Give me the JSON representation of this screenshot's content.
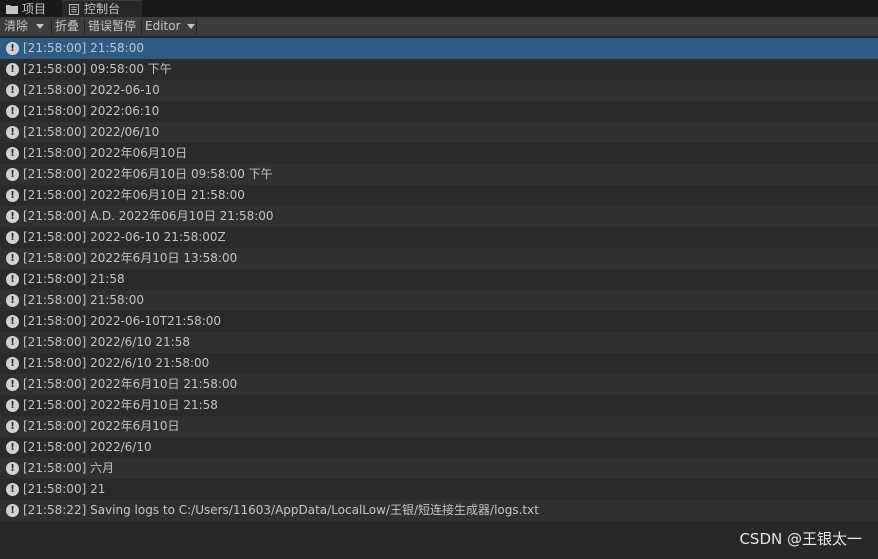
{
  "tabs": [
    {
      "label": "项目",
      "icon": "folder-icon"
    },
    {
      "label": "控制台",
      "icon": "console-icon"
    }
  ],
  "toolbar": {
    "clear_label": "清除",
    "collapse_label": "折叠",
    "error_pause_label": "错误暂停",
    "editor_label": "Editor"
  },
  "logs": [
    "[21:58:00] 21:58:00",
    "[21:58:00] 09:58:00 下午",
    "[21:58:00] 2022-06-10",
    "[21:58:00] 2022:06:10",
    "[21:58:00] 2022/06/10",
    "[21:58:00] 2022年06月10日",
    "[21:58:00] 2022年06月10日 09:58:00 下午",
    "[21:58:00] 2022年06月10日 21:58:00",
    "[21:58:00] A.D. 2022年06月10日 21:58:00",
    "[21:58:00] 2022-06-10 21:58:00Z",
    "[21:58:00] 2022年6月10日 13:58:00",
    "[21:58:00] 21:58",
    "[21:58:00] 21:58:00",
    "[21:58:00] 2022-06-10T21:58:00",
    "[21:58:00] 2022/6/10 21:58",
    "[21:58:00] 2022/6/10 21:58:00",
    "[21:58:00] 2022年6月10日 21:58:00",
    "[21:58:00] 2022年6月10日 21:58",
    "[21:58:00] 2022年6月10日",
    "[21:58:00] 2022/6/10",
    "[21:58:00] 六月",
    "[21:58:00] 21",
    "[21:58:22] Saving logs to C:/Users/11603/AppData/LocalLow/王银/短连接生成器/logs.txt"
  ],
  "watermark": "CSDN @王银太一",
  "colors": {
    "selected_row": "#2c5d87",
    "background": "#282828",
    "toolbar": "#3c3c3c"
  }
}
